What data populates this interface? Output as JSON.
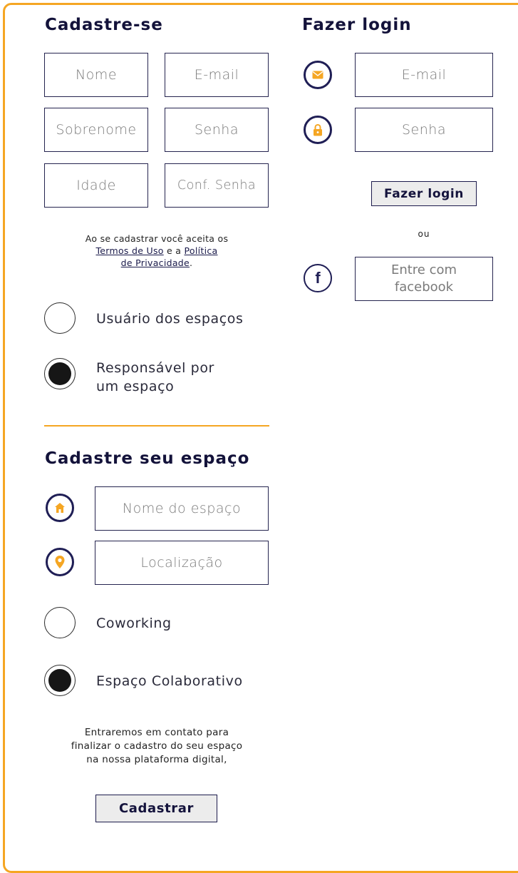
{
  "signup": {
    "title": "Cadastre-se",
    "fields": {
      "first_name": {
        "placeholder": "Nome",
        "value": ""
      },
      "email": {
        "placeholder": "E-mail",
        "value": ""
      },
      "last_name": {
        "placeholder": "Sobrenome",
        "value": ""
      },
      "password": {
        "placeholder": "Senha",
        "value": ""
      },
      "age": {
        "placeholder": "Idade",
        "value": ""
      },
      "confirm_password": {
        "placeholder": "Conf. Senha",
        "value": ""
      }
    },
    "terms": {
      "prefix": "Ao se cadastrar você aceita os",
      "terms_link": "Termos de Uso",
      "connector": "e a",
      "privacy_link_1": "Política",
      "privacy_link_2": "de Privacidade",
      "suffix": "."
    },
    "user_type": {
      "options": [
        {
          "label": "Usuário dos espaços",
          "selected": false
        },
        {
          "label_line1": "Responsável por",
          "label_line2": "um espaço",
          "selected": true
        }
      ]
    }
  },
  "space": {
    "title": "Cadastre seu espaço",
    "fields": {
      "name": {
        "placeholder": "Nome do espaço",
        "icon": "home-icon",
        "value": ""
      },
      "location": {
        "placeholder": "Localização",
        "icon": "location-pin-icon",
        "value": ""
      }
    },
    "space_type": {
      "options": [
        {
          "label": "Coworking",
          "selected": false
        },
        {
          "label": "Espaço Colaborativo",
          "selected": true
        }
      ]
    },
    "note": {
      "line1": "Entraremos em contato para",
      "line2": "finalizar o cadastro do seu espaço",
      "line3": "na nossa plataforma digital,"
    },
    "submit_label": "Cadastrar"
  },
  "login": {
    "title": "Fazer login",
    "fields": {
      "email": {
        "placeholder": "E-mail",
        "icon": "envelope-icon",
        "value": ""
      },
      "password": {
        "placeholder": "Senha",
        "icon": "lock-icon",
        "value": ""
      }
    },
    "submit_label": "Fazer login",
    "or_text": "ou",
    "facebook": {
      "icon": "facebook-icon",
      "placeholder": "Entre com\nfacebook"
    }
  },
  "colors": {
    "accent": "#f5a623",
    "navy": "#1f1e55",
    "button_bg": "#ececec"
  }
}
